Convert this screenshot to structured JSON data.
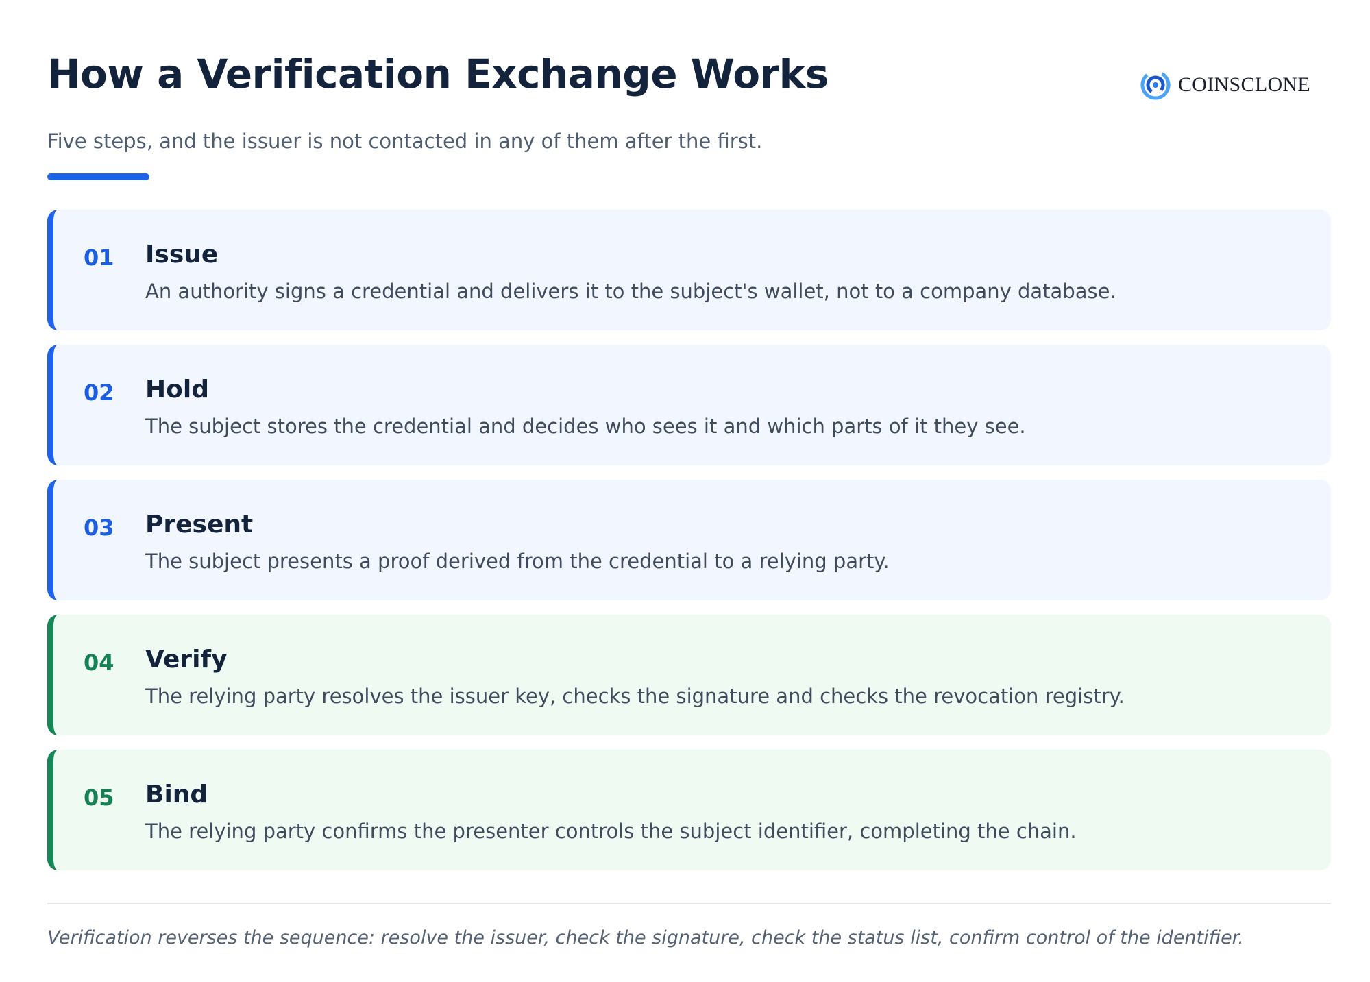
{
  "header": {
    "title": "How a Verification Exchange Works",
    "subtitle": "Five steps, and the issuer is not contacted in any of them after the first.",
    "brand": "COINSCLONE"
  },
  "steps": [
    {
      "number": "01",
      "title": "Issue",
      "description": "An authority signs a credential and delivers it to the subject's wallet, not to a company database.",
      "accent": "#1e63e9"
    },
    {
      "number": "02",
      "title": "Hold",
      "description": "The subject stores the credential and decides who sees it and which parts of it they see.",
      "accent": "#1e63e9"
    },
    {
      "number": "03",
      "title": "Present",
      "description": "The subject presents a proof derived from the credential to a relying party.",
      "accent": "#1e63e9"
    },
    {
      "number": "04",
      "title": "Verify",
      "description": "The relying party resolves the issuer key, checks the signature and checks the revocation registry.",
      "accent": "#178758"
    },
    {
      "number": "05",
      "title": "Bind",
      "description": "The relying party confirms the presenter controls the subject identifier, completing the chain.",
      "accent": "#178758"
    }
  ],
  "footer": {
    "note": "Verification reverses the sequence: resolve the issuer, check the signature, check the status list, confirm control of the identifier."
  },
  "colors": {
    "blue_accent": "#1e63e9",
    "green_accent": "#178758",
    "title_text": "#14233c"
  }
}
